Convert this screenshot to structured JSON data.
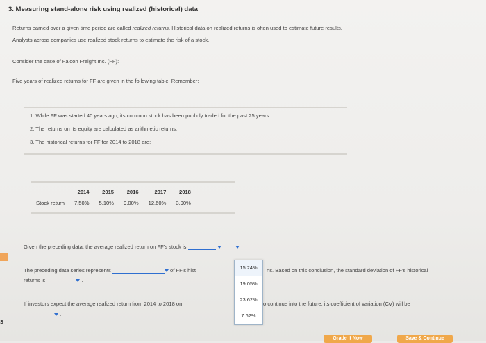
{
  "section_title": "3. Measuring stand-alone risk using realized (historical) data",
  "intro": {
    "line1_pre": "Returns earned over a given time period are called ",
    "line1_em": "realized returns",
    "line1_post": ". Historical data on realized returns is often used to estimate future results.",
    "line2": "Analysts across companies use realized stock returns to estimate the risk of a stock."
  },
  "case_line": "Consider the case of Falcon Freight Inc. (FF):",
  "five_years_line": "Five years of realized returns for FF are given in the following table. Remember:",
  "remember_list": [
    "1. While FF was started 40 years ago, its common stock has been publicly traded for the past 25 years.",
    "2. The returns on its equity are calculated as arithmetic returns.",
    "3. The historical returns for FF for 2014 to 2018 are:"
  ],
  "returns_table": {
    "headers": [
      "2014",
      "2015",
      "2016",
      "2017",
      "2018"
    ],
    "row_label": "Stock return",
    "values": [
      "7.50%",
      "5.10%",
      "9.00%",
      "12.60%",
      "3.90%"
    ]
  },
  "q1": {
    "text": "Given the preceding data, the average realized return on FF's stock is"
  },
  "q2": {
    "pre": "The preceding data series represents",
    "mid": "of FF's hist",
    "post": "ns. Based on this conclusion, the standard deviation of FF's historical",
    "line2": "returns is"
  },
  "q3": {
    "pre": "If investors expect the average realized return from 2014 to 2018 on",
    "post": "o continue into the future, its coefficient of variation (CV) will be"
  },
  "dropdown_options": [
    "15.24%",
    "19.05%",
    "23.62%",
    "7.62%"
  ],
  "side_marker": "s",
  "buttons": {
    "grade": "Grade It Now",
    "save": "Save & Continue"
  },
  "colors": {
    "accent_blue": "#2f6fd0",
    "button_orange": "#f0a84a"
  }
}
